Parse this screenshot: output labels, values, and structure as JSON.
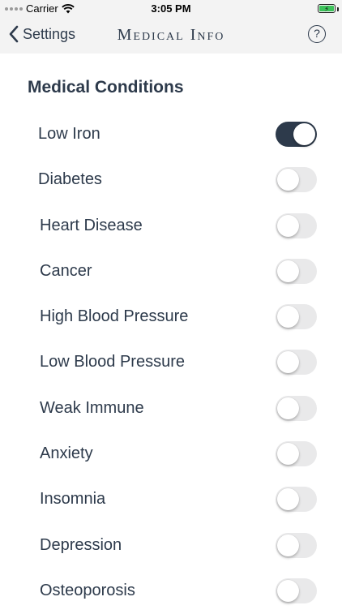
{
  "status_bar": {
    "carrier": "Carrier",
    "time": "3:05 PM"
  },
  "nav": {
    "back_label": "Settings",
    "title": "Medical Info",
    "help_label": "?"
  },
  "section": {
    "title": "Medical Conditions"
  },
  "conditions": [
    {
      "label": "Low Iron",
      "on": true
    },
    {
      "label": "Diabetes",
      "on": false
    },
    {
      "label": "Heart Disease",
      "on": false
    },
    {
      "label": "Cancer",
      "on": false
    },
    {
      "label": "High Blood Pressure",
      "on": false
    },
    {
      "label": "Low Blood Pressure",
      "on": false
    },
    {
      "label": "Weak Immune",
      "on": false
    },
    {
      "label": "Anxiety",
      "on": false
    },
    {
      "label": "Insomnia",
      "on": false
    },
    {
      "label": "Depression",
      "on": false
    },
    {
      "label": "Osteoporosis",
      "on": false
    }
  ],
  "colors": {
    "accent": "#2d3a4b",
    "toggle_off": "#e9e9ea",
    "battery": "#3cc25a"
  }
}
